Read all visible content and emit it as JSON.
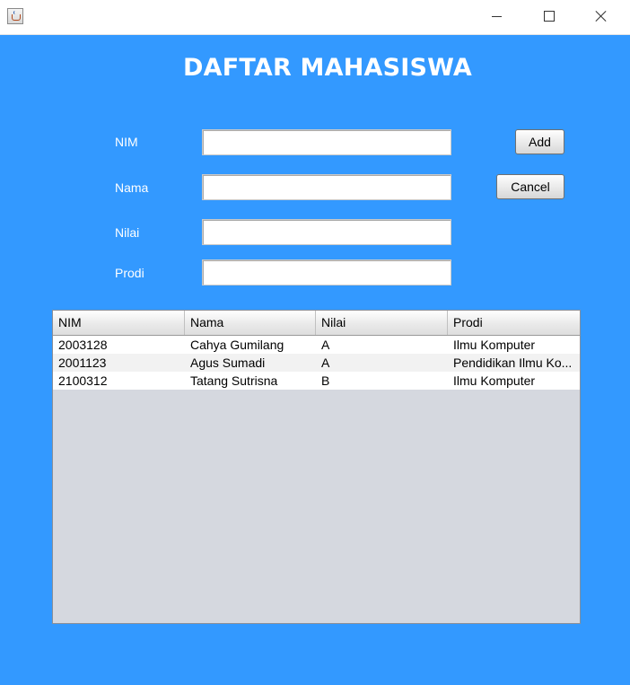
{
  "window": {
    "controls": {
      "minimize": "minimize-icon",
      "maximize": "maximize-icon",
      "close": "close-icon"
    }
  },
  "form": {
    "title": "DAFTAR MAHASISWA",
    "nim_label": "NIM",
    "nama_label": "Nama",
    "nilai_label": "Nilai",
    "prodi_label": "Prodi",
    "nim_value": "",
    "nama_value": "",
    "nilai_value": "",
    "prodi_value": "",
    "add_label": "Add",
    "cancel_label": "Cancel"
  },
  "table": {
    "columns": [
      "NIM",
      "Nama",
      "Nilai",
      "Prodi"
    ],
    "rows": [
      [
        "2003128",
        "Cahya Gumilang",
        "A",
        "Ilmu Komputer"
      ],
      [
        "2001123",
        "Agus Sumadi",
        "A",
        "Pendidikan Ilmu Ko..."
      ],
      [
        "2100312",
        "Tatang Sutrisna",
        "B",
        "Ilmu Komputer"
      ]
    ]
  },
  "colors": {
    "background": "#3399ff",
    "table_empty": "#d5d8df"
  }
}
